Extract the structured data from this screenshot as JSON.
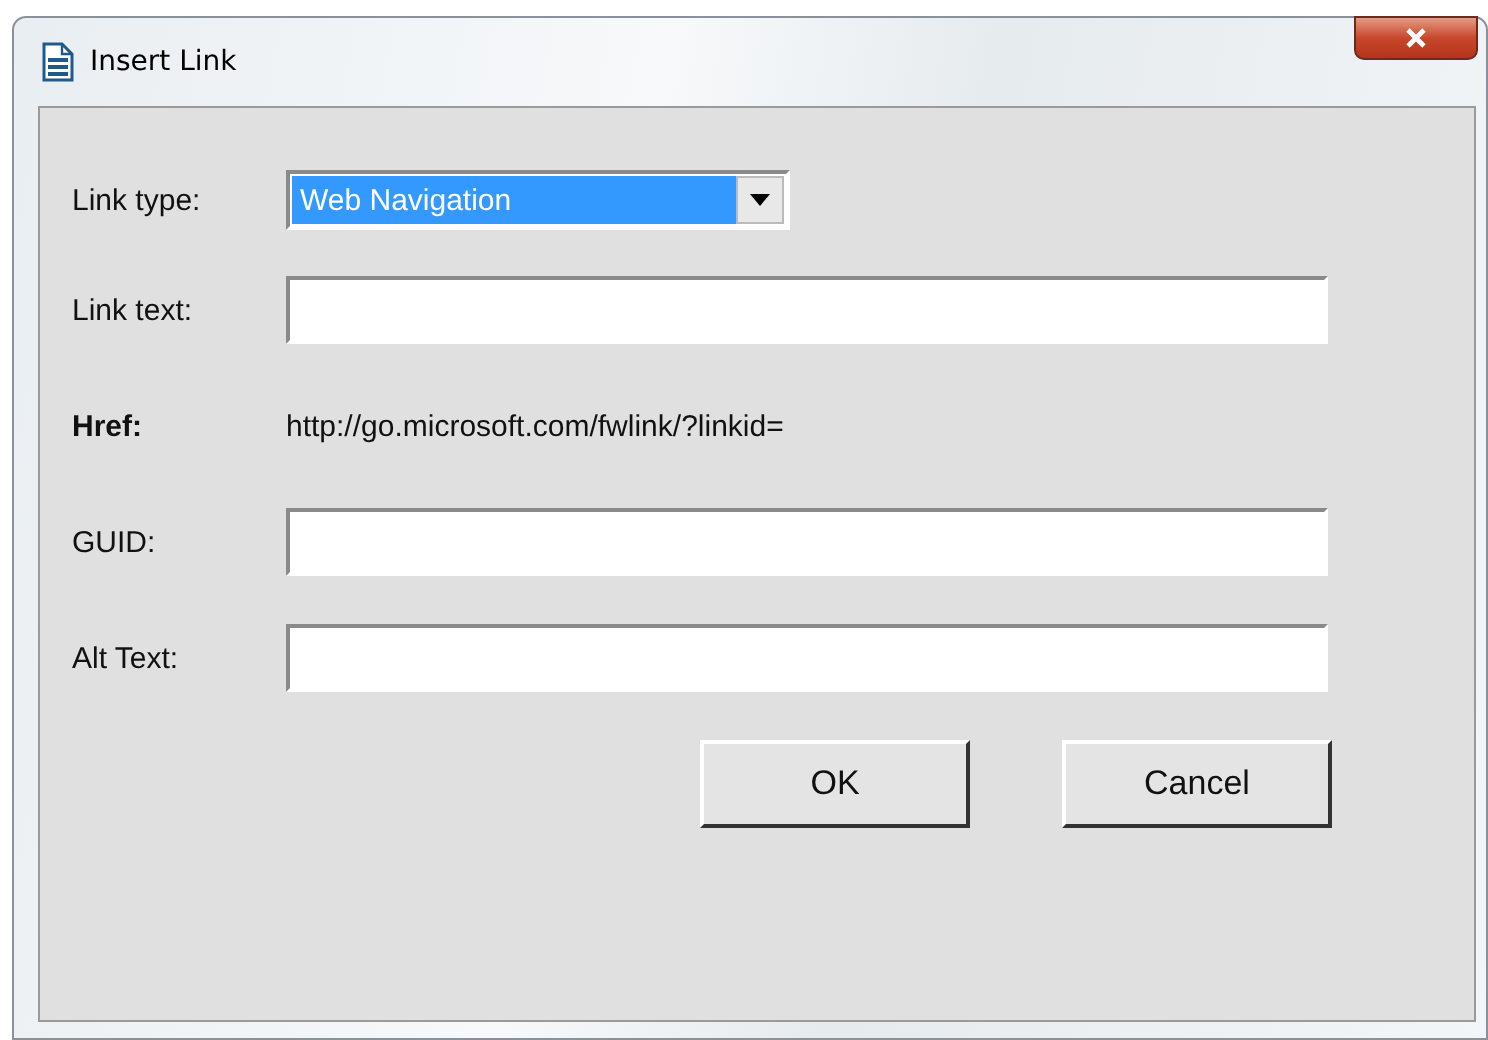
{
  "window": {
    "title": "Insert Link"
  },
  "fields": [
    {
      "kind": "dropdown",
      "label": "Link type:",
      "value": "Web Navigation",
      "selected": true
    },
    {
      "kind": "text",
      "label": "Link text:"
    },
    {
      "kind": "static",
      "label": "Href:",
      "value": "http://go.microsoft.com/fwlink/?linkid="
    },
    {
      "kind": "text",
      "label": "GUID:"
    },
    {
      "kind": "text",
      "label": "Alt Text:"
    }
  ],
  "buttons": [
    "OK",
    "Cancel"
  ]
}
